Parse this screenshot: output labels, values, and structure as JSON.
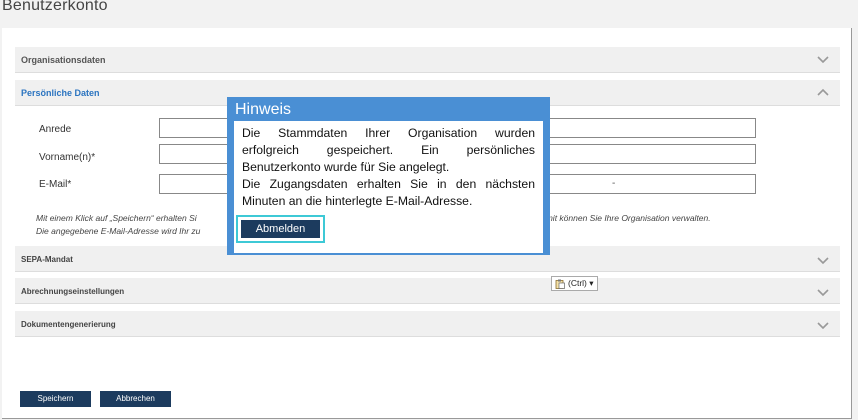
{
  "page": {
    "title": "Benutzerkonto"
  },
  "sections": {
    "organisation": "Organisationsdaten",
    "personal": "Persönliche Daten",
    "sepa": "SEPA-Mandat",
    "billing": "Abrechnungseinstellungen",
    "documents": "Dokumentengenerierung"
  },
  "form": {
    "salutation_label": "Anrede",
    "firstname_label": "Vorname(n)*",
    "email_label": "E-Mail*",
    "email_value_fragment": "-",
    "note_line1_start": "Mit einem Klick auf „Speichern“ erhalten Si",
    "note_line1_end": "amit können Sie Ihre Organisation verwalten.",
    "note_line2_start": "Die angegebene E-Mail-Adresse wird Ihr zu"
  },
  "buttons": {
    "save": "Speichern",
    "cancel": "Abbrechen"
  },
  "modal": {
    "title": "Hinweis",
    "text1": "Die Stammdaten Ihrer Organisation wurden erfolgreich gespeichert. Ein persönliches Benutzerkonto wurde für Sie angelegt.",
    "text2": "Die Zugangsdaten erhalten Sie in den nächsten Minuten an die hinterlegte E-Mail-Adresse.",
    "logout": "Abmelden"
  },
  "paste_options": {
    "label": "(Ctrl)",
    "arrow": "▾"
  },
  "colors": {
    "accent": "#2b74c0",
    "button": "#1c3b5e",
    "modal": "#4a8fd4",
    "focus": "#3dc9d6"
  }
}
